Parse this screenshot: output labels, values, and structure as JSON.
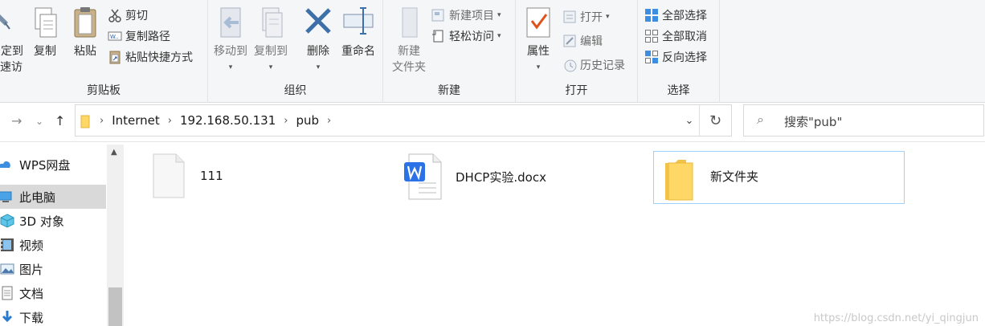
{
  "ribbon": {
    "clipboard": {
      "pin_label_line1": "固定到",
      "pin_label_line2": "快速访问",
      "copy": "复制",
      "paste": "粘贴",
      "cut": "剪切",
      "copy_path": "复制路径",
      "paste_shortcut": "粘贴快捷方式",
      "group": "剪贴板"
    },
    "organize": {
      "move_to": "移动到",
      "copy_to": "复制到",
      "delete": "删除",
      "rename": "重命名",
      "group": "组织"
    },
    "new": {
      "new_folder_line1": "新建",
      "new_folder_line2": "文件夹",
      "new_item": "新建项目",
      "easy_access": "轻松访问",
      "group": "新建"
    },
    "open": {
      "properties": "属性",
      "open": "打开",
      "edit": "编辑",
      "history": "历史记录",
      "group": "打开"
    },
    "select": {
      "select_all": "全部选择",
      "select_none": "全部取消",
      "invert": "反向选择",
      "group": "选择"
    }
  },
  "address": {
    "crumbs": [
      "Internet",
      "192.168.50.131",
      "pub"
    ]
  },
  "search": {
    "placeholder": "搜索\"pub\""
  },
  "nav": {
    "items": [
      {
        "label": "WPS网盘",
        "icon": "cloud-icon"
      },
      {
        "label": "此电脑",
        "icon": "computer-icon",
        "selected": true
      },
      {
        "label": "3D 对象",
        "icon": "cube-icon"
      },
      {
        "label": "视频",
        "icon": "video-icon"
      },
      {
        "label": "图片",
        "icon": "picture-icon"
      },
      {
        "label": "文档",
        "icon": "document-icon"
      },
      {
        "label": "下载",
        "icon": "download-icon"
      }
    ]
  },
  "files": [
    {
      "name": "111",
      "type": "blank-file-icon"
    },
    {
      "name": "DHCP实验.docx",
      "type": "wps-doc-icon"
    },
    {
      "name": "新文件夹",
      "type": "folder-icon",
      "selected": true
    }
  ],
  "watermark": "https://blog.csdn.net/yi_qingjun",
  "colors": {
    "accent": "#0078d7",
    "selection_border": "#99d1ff",
    "folder": "#ffd766",
    "wps": "#2b72e8",
    "delete": "#3d6fa8"
  }
}
